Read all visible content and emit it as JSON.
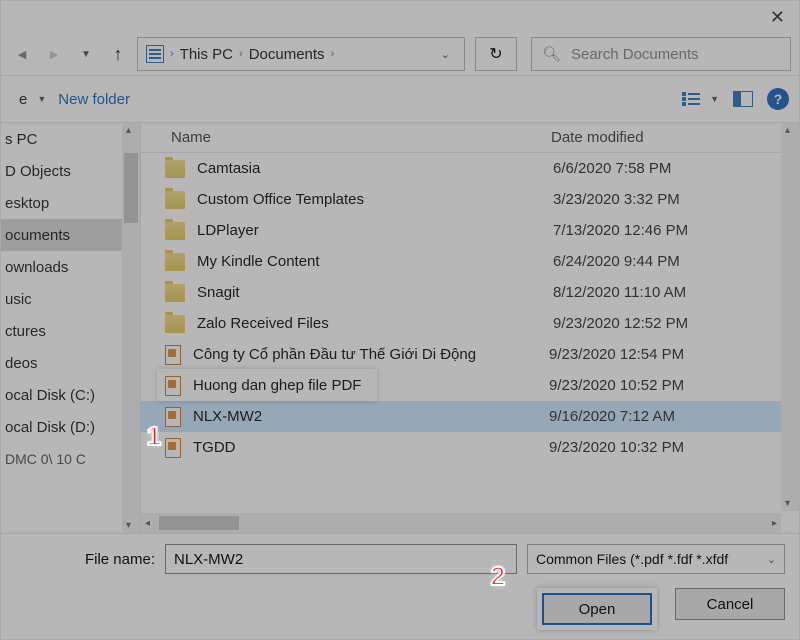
{
  "breadcrumb": {
    "root": "This PC",
    "folder": "Documents"
  },
  "search": {
    "placeholder": "Search Documents"
  },
  "toolbar": {
    "new_folder": "New folder",
    "help": "?"
  },
  "columns": {
    "name": "Name",
    "date": "Date modified"
  },
  "sidebar": {
    "items": [
      "s PC",
      "D Objects",
      "esktop",
      "ocuments",
      "ownloads",
      "usic",
      "ctures",
      "deos",
      "ocal Disk (C:)",
      "ocal Disk (D:)"
    ],
    "selected_index": 3,
    "trailing": "DMC 0\\ 10 C"
  },
  "files": [
    {
      "icon": "folder",
      "name": "Camtasia",
      "date": "6/6/2020 7:58 PM"
    },
    {
      "icon": "folder",
      "name": "Custom Office Templates",
      "date": "3/23/2020 3:32 PM"
    },
    {
      "icon": "folder",
      "name": "LDPlayer",
      "date": "7/13/2020 12:46 PM"
    },
    {
      "icon": "folder",
      "name": "My Kindle Content",
      "date": "6/24/2020 9:44 PM"
    },
    {
      "icon": "folder",
      "name": "Snagit",
      "date": "8/12/2020 11:10 AM"
    },
    {
      "icon": "folder",
      "name": "Zalo Received Files",
      "date": "9/23/2020 12:52 PM"
    },
    {
      "icon": "pdf",
      "name": "Công ty Cổ phần Đầu tư Thế Giới Di Động",
      "date": "9/23/2020 12:54 PM"
    },
    {
      "icon": "pdf",
      "name": "Huong dan ghep file PDF",
      "date": "9/23/2020 10:52 PM"
    },
    {
      "icon": "pdf",
      "name": "NLX-MW2",
      "date": "9/16/2020 7:12 AM",
      "selected": true
    },
    {
      "icon": "pdf",
      "name": "TGDD",
      "date": "9/23/2020 10:32 PM"
    }
  ],
  "filename": {
    "label": "File name:",
    "value": "NLX-MW2"
  },
  "filetype": "Common Files (*.pdf *.fdf *.xfdf",
  "buttons": {
    "open": "Open",
    "cancel": "Cancel"
  },
  "callouts": {
    "one": "1",
    "two": "2"
  }
}
